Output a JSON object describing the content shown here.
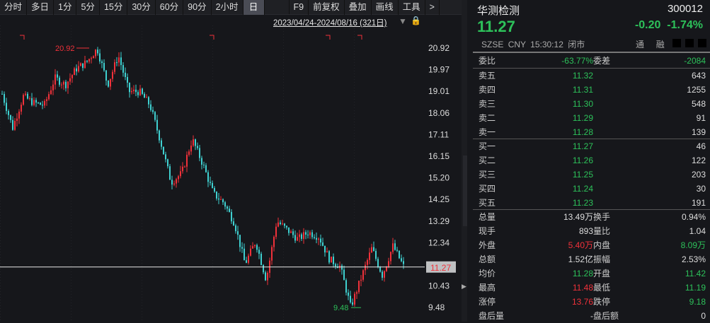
{
  "toolbar": {
    "tabs": [
      "分时",
      "多日",
      "1分",
      "5分",
      "15分",
      "30分",
      "60分",
      "90分",
      "2小时",
      "日"
    ],
    "active": "日",
    "tools": [
      "F9",
      "前复权",
      "叠加",
      "画线",
      "工具",
      ">"
    ]
  },
  "range": {
    "label": "2023/04/24-2024/08/16 (321日)",
    "arrow": "▼",
    "lock_icon": "lock-icon"
  },
  "colors": {
    "up": "#f0313a",
    "down": "#3fd0d0",
    "green": "#2dc15a",
    "red": "#f0313a",
    "lock": "#f0a81c"
  },
  "chart_data": {
    "type": "candlestick",
    "period": "日",
    "ylim": [
      9.48,
      20.92
    ],
    "y_ticks": [
      "20.92",
      "19.97",
      "19.01",
      "18.06",
      "17.11",
      "16.15",
      "15.20",
      "14.25",
      "13.29",
      "12.34",
      "11.38",
      "10.43",
      "9.48"
    ],
    "high_label": "20.92",
    "low_label": "9.48",
    "last_price": "11.27",
    "close_path": [
      18.9,
      17.4,
      18.8,
      18.5,
      18.4,
      19.6,
      19.3,
      20.0,
      20.3,
      20.9,
      19.3,
      20.6,
      19.0,
      19.0,
      18.4,
      16.8,
      15.0,
      15.4,
      16.9,
      15.8,
      14.5,
      14.1,
      13.2,
      11.4,
      12.4,
      10.7,
      13.3,
      12.9,
      12.5,
      12.8,
      12.6,
      11.6,
      11.3,
      9.5,
      10.8,
      12.1,
      10.9,
      12.2,
      11.3
    ]
  },
  "quote": {
    "name": "华测检测",
    "code": "300012",
    "price": "11.27",
    "change": "-0.20",
    "pct": "-1.74%",
    "exchange": "SZSE",
    "currency": "CNY",
    "time": "15:30:12",
    "status": "闭市",
    "tags": [
      "通",
      "融"
    ]
  },
  "weibi": {
    "label": "委比",
    "value": "-63.77%",
    "label2": "委差",
    "value2": "-2084"
  },
  "asks": [
    {
      "label": "卖五",
      "price": "11.32",
      "vol": "643"
    },
    {
      "label": "卖四",
      "price": "11.31",
      "vol": "1255"
    },
    {
      "label": "卖三",
      "price": "11.30",
      "vol": "548"
    },
    {
      "label": "卖二",
      "price": "11.29",
      "vol": "91"
    },
    {
      "label": "卖一",
      "price": "11.28",
      "vol": "139"
    }
  ],
  "bids": [
    {
      "label": "买一",
      "price": "11.27",
      "vol": "46"
    },
    {
      "label": "买二",
      "price": "11.26",
      "vol": "122"
    },
    {
      "label": "买三",
      "price": "11.25",
      "vol": "203"
    },
    {
      "label": "买四",
      "price": "11.24",
      "vol": "30"
    },
    {
      "label": "买五",
      "price": "11.23",
      "vol": "191"
    }
  ],
  "stats": [
    {
      "l": "总量",
      "v": "13.49万",
      "c": "w",
      "l2": "换手",
      "v2": "0.94%",
      "c2": "w"
    },
    {
      "l": "现手",
      "v": "893",
      "c": "w",
      "l2": "量比",
      "v2": "1.04",
      "c2": "w"
    },
    {
      "l": "外盘",
      "v": "5.40万",
      "c": "r",
      "l2": "内盘",
      "v2": "8.09万",
      "c2": "g"
    },
    {
      "l": "总额",
      "v": "1.52亿",
      "c": "w",
      "l2": "振幅",
      "v2": "2.53%",
      "c2": "w"
    },
    {
      "l": "均价",
      "v": "11.28",
      "c": "g",
      "l2": "开盘",
      "v2": "11.42",
      "c2": "g"
    },
    {
      "l": "最高",
      "v": "11.48",
      "c": "r",
      "l2": "最低",
      "v2": "11.19",
      "c2": "g"
    },
    {
      "l": "涨停",
      "v": "13.76",
      "c": "r",
      "l2": "跌停",
      "v2": "9.18",
      "c2": "g"
    },
    {
      "l": "盘后量",
      "v": "-",
      "c": "w",
      "l2": "盘后额",
      "v2": "0",
      "c2": "w"
    }
  ]
}
